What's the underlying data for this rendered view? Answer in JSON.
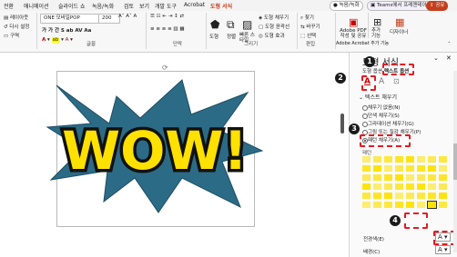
{
  "tabs": [
    "전환",
    "애니메이션",
    "슬라이드 쇼",
    "녹음/녹화",
    "검토",
    "보기",
    "개발 도구",
    "Acrobat",
    "도형 서식"
  ],
  "ribbon": {
    "layout_label": "레이아웃",
    "reset_label": "다시 설정",
    "section_label": "구역",
    "font_name": "ONE 모바일POP",
    "font_size": "200",
    "font_group": "글꼴",
    "para_group": "단락",
    "draw_group": "그리기",
    "shape_label": "도형",
    "arrange_label": "정렬",
    "quickstyle_label": "빠른 스타일",
    "fill_label": "도형 채우기",
    "outline_label": "도형 윤곽선",
    "effect_label": "도형 효과",
    "find_label": "찾기",
    "replace_label": "바꾸기",
    "select_label": "선택",
    "edit_group": "편집",
    "acrobat_label": "Adobe PDF 작성 및 공유",
    "acrobat_group": "Adobe Acrobat 추가 기능",
    "addin_label": "추가 기능",
    "designer_label": "디자이너",
    "record_label": "녹음/녹화",
    "teams_label": "Teams에서 프레젠테이션",
    "share_label": "공유"
  },
  "slide": {
    "text": "WOW!"
  },
  "pane": {
    "title": "도형 서식",
    "tab_shape": "도형 옵션",
    "tab_text": "텍스트 옵션",
    "section": "텍스트 채우기",
    "options": [
      "채우기 없음(N)",
      "단색 채우기(S)",
      "그라데이션 채우기(G)",
      "그림 또는 질감 채우기(P)",
      "패턴 채우기(A)"
    ],
    "pattern_label": "패턴",
    "fg_label": "전경색(E)",
    "bg_label": "배경(C)"
  },
  "badges": [
    "1",
    "2",
    "3",
    "4"
  ],
  "colors": {
    "accent": "#c43e1c",
    "callout": "#e31b23",
    "pattern_yellow": "#ffe100",
    "star": "#2c6b86"
  }
}
